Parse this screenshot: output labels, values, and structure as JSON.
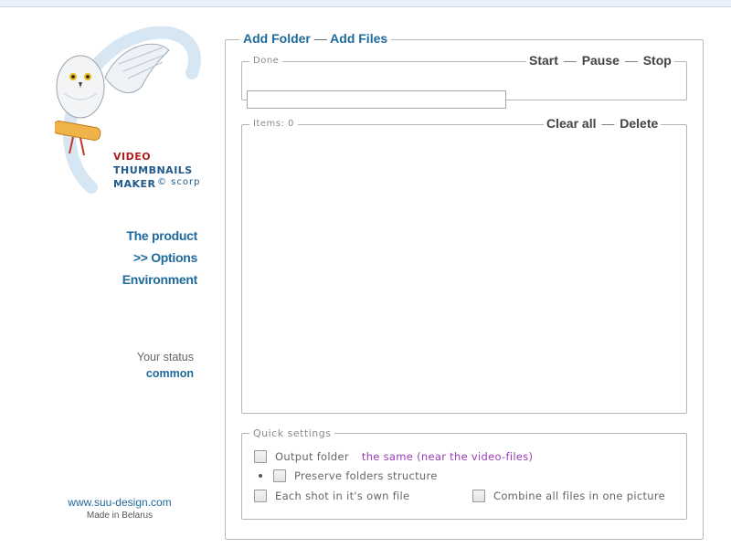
{
  "app": {
    "logo": {
      "line1": "VIDEO",
      "line2": "THUMBNAILS",
      "line3": "MAKER",
      "copyright": "© scorp"
    },
    "nav": [
      {
        "label": "The product"
      },
      {
        "label": ">> Options"
      },
      {
        "label": "Environment"
      }
    ],
    "status": {
      "label": "Your status",
      "value": "common"
    },
    "footer": {
      "link": "www.suu-design.com",
      "sub": "Made in Belarus"
    }
  },
  "main": {
    "add_folder": "Add Folder",
    "sep": "—",
    "add_files": "Add Files",
    "progress": {
      "label": "Done",
      "start": "Start",
      "pause": "Pause",
      "stop": "Stop",
      "value": 0
    },
    "items": {
      "label": "Items: 0",
      "clear_all": "Clear all",
      "delete": "Delete"
    },
    "quick": {
      "label": "Quick settings",
      "output_folder": "Output  folder",
      "output_folder_value": "the same (near the video-files)",
      "preserve": "Preserve folders structure",
      "each_shot": "Each shot in it's own file",
      "combine": "Combine all files in one picture"
    }
  },
  "colors": {
    "accent": "#1e6a9c",
    "logo_red": "#b01c1c",
    "purple": "#9a3cb8"
  }
}
